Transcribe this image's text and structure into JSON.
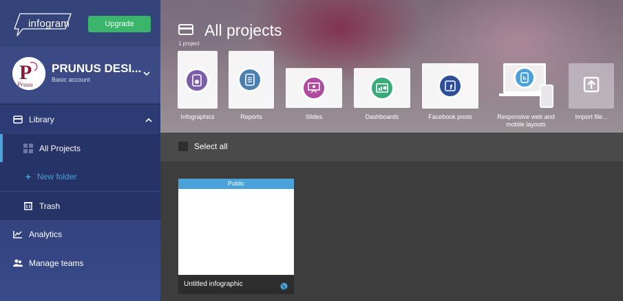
{
  "sidebar": {
    "logo_text": "infogram",
    "upgrade_label": "Upgrade",
    "account": {
      "name": "PRUNUS DESI...",
      "plan": "Basic account",
      "avatar_text": "Pruuu"
    },
    "nav": {
      "library": "Library",
      "all_projects": "All Projects",
      "new_folder": "New folder",
      "trash": "Trash",
      "analytics": "Analytics",
      "manage_teams": "Manage teams"
    }
  },
  "header": {
    "title": "All projects",
    "count": "1 project"
  },
  "templates": [
    {
      "label": "Infographics",
      "icon": "infographic-icon",
      "color": "#7a5fa8"
    },
    {
      "label": "Reports",
      "icon": "report-icon",
      "color": "#4a7fb0"
    },
    {
      "label": "Slides",
      "icon": "slides-icon",
      "color": "#b04a9e"
    },
    {
      "label": "Dashboards",
      "icon": "dashboard-icon",
      "color": "#3aaa7a"
    },
    {
      "label": "Facebook posts",
      "icon": "facebook-icon",
      "color": "#2d4f9a"
    },
    {
      "label": "Responsive web and mobile layouts",
      "icon": "responsive-icon",
      "color": "#4aa2d8"
    },
    {
      "label": "Import file...",
      "icon": "import-icon",
      "color": "#ffffff"
    }
  ],
  "select_all": "Select all",
  "project": {
    "visibility": "Public",
    "name": "Untitled infographic"
  },
  "colors": {
    "accent_blue": "#4aa2d8",
    "upgrade_green": "#3bb56c",
    "sidebar_bg": "#2c3a6e"
  }
}
